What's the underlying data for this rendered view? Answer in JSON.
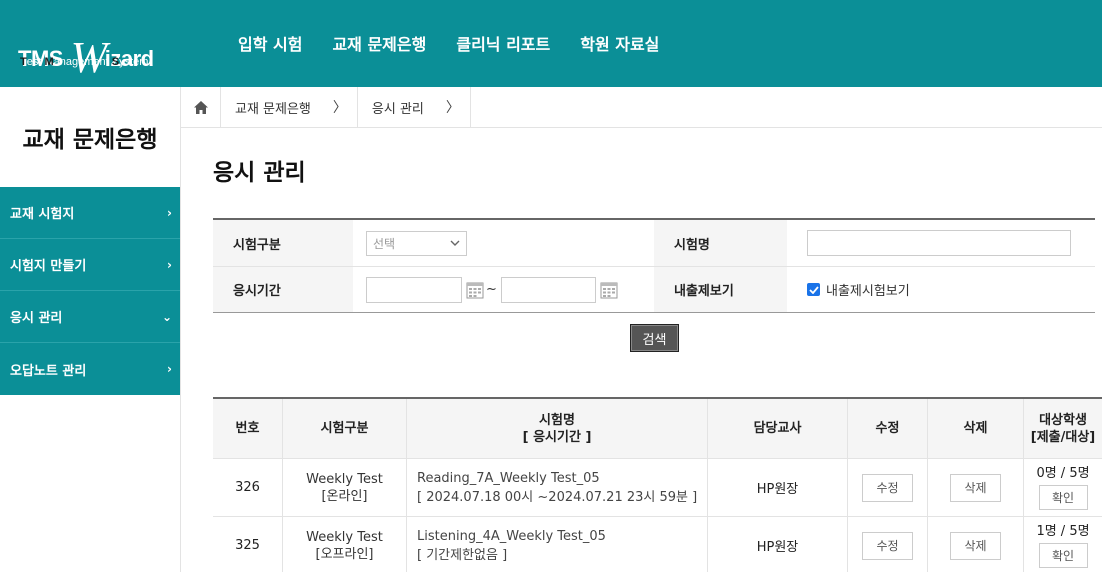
{
  "logo": {
    "main_prefix": "TMS ",
    "main_w": "W",
    "main_suffix": "izard",
    "sub_t": "T",
    "sub_1": "est ",
    "sub_m": "M",
    "sub_2": "anagement ",
    "sub_s": "S",
    "sub_3": "ystem"
  },
  "gnb": [
    "입학 시험",
    "교재 문제은행",
    "클리닉 리포트",
    "학원 자료실"
  ],
  "sidebar": {
    "title": "교재 문제은행",
    "items": [
      {
        "label": "교재 시험지",
        "chevron": "›"
      },
      {
        "label": "시험지 만들기",
        "chevron": "›"
      },
      {
        "label": "응시 관리",
        "chevron": "⌄"
      },
      {
        "label": "오답노트 관리",
        "chevron": "›"
      }
    ]
  },
  "breadcrumb": {
    "items": [
      "교재 문제은행",
      "응시 관리"
    ],
    "sep": "〉"
  },
  "page_title": "응시 관리",
  "search": {
    "type_label": "시험구분",
    "type_select": "선택",
    "name_label": "시험명",
    "name_value": "",
    "period_label": "응시기간",
    "period_start": "",
    "period_end": "",
    "tilde": "~",
    "show_label": "내출제보기",
    "show_check_label": "내출제시험보기",
    "button": "검색"
  },
  "table": {
    "headers": {
      "no": "번호",
      "type": "시험구분",
      "name_line1": "시험명",
      "name_line2": "[ 응시기간 ]",
      "teacher": "담당교사",
      "edit": "수정",
      "delete": "삭제",
      "target_line1": "대상학생",
      "target_line2": "[제출/대상]"
    },
    "rows": [
      {
        "no": "326",
        "type_line1": "Weekly Test",
        "type_line2": "[온라인]",
        "name": "Reading_7A_Weekly Test_05",
        "period": "[ 2024.07.18 00시 ~2024.07.21 23시 59분 ]",
        "teacher": "HP원장",
        "edit": "수정",
        "delete": "삭제",
        "count": "0명 / 5명",
        "confirm": "확인"
      },
      {
        "no": "325",
        "type_line1": "Weekly Test",
        "type_line2": "[오프라인]",
        "name": "Listening_4A_Weekly Test_05",
        "period": "[ 기간제한없음 ]",
        "teacher": "HP원장",
        "edit": "수정",
        "delete": "삭제",
        "count": "1명 / 5명",
        "confirm": "확인"
      }
    ]
  },
  "colors": {
    "brand": "#0b8f97",
    "check": "#1a73e8"
  }
}
